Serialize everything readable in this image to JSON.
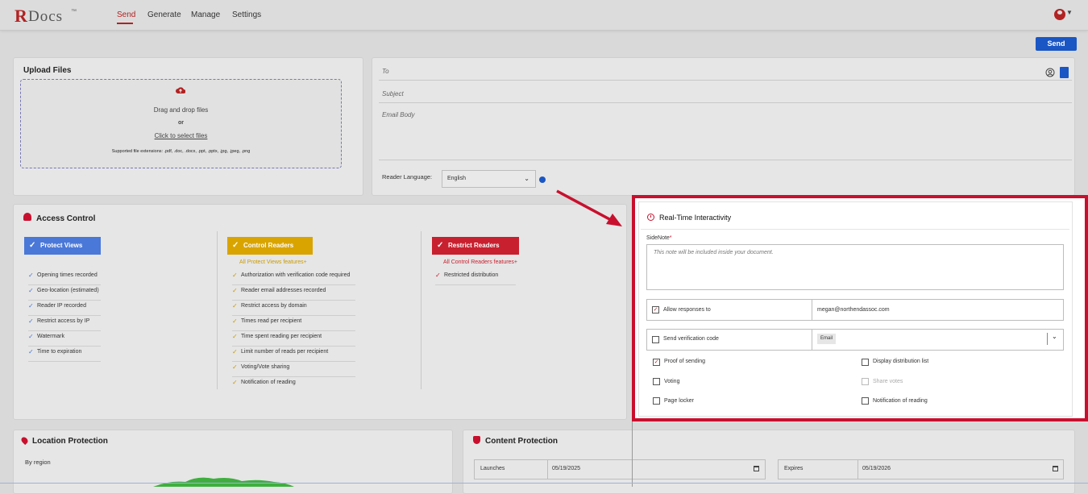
{
  "app": {
    "logo_r": "R",
    "logo_docs": "Docs",
    "logo_tm": "™"
  },
  "nav": {
    "items": [
      "Send",
      "Generate",
      "Manage",
      "Settings"
    ],
    "active": "Send"
  },
  "toolbar": {
    "send_label": "Send"
  },
  "upload": {
    "title": "Upload Files",
    "drag_text": "Drag and drop files",
    "or_text": "or",
    "select_link": "Click to select files",
    "extensions": "Supported file extensions: .pdf, .doc, .docx, .ppt, .pptx, .jpg, .jpeg, .png"
  },
  "compose": {
    "to_label": "To",
    "subject_label": "Subject",
    "body_label": "Email Body",
    "reader_language_label": "Reader Language:",
    "reader_language_value": "English"
  },
  "access": {
    "title": "Access Control",
    "protect": {
      "label": "Protect Views",
      "color": "#4a78d8",
      "features": [
        "Opening times recorded",
        "Geo-location (estimated)",
        "Reader IP recorded",
        "Restrict access by IP",
        "Watermark",
        "Time to expiration"
      ]
    },
    "control": {
      "label": "Control Readers",
      "color": "#d9a400",
      "note": "All Protect Views features+",
      "features": [
        "Authorization with verification code required",
        "Reader email addresses recorded",
        "Restrict access by domain",
        "Times read per recipient",
        "Time spent reading per recipient",
        "Limit number of reads per recipient",
        "Voting/Vote sharing",
        "Notification of reading"
      ]
    },
    "restrict": {
      "label": "Restrict Readers",
      "color": "#c8202f",
      "note": "All Control Readers features+",
      "features": [
        "Restricted distribution"
      ]
    }
  },
  "realtime": {
    "title": "Real-Time Interactivity",
    "sidenote_label": "SideNote",
    "sidenote_required": "*",
    "sidenote_placeholder": "This note will be included inside your document.",
    "allow_responses_label": "Allow responses to",
    "allow_responses_checked": true,
    "allow_responses_email": "megan@northendassoc.com",
    "verification_label": "Send verification code",
    "verification_checked": false,
    "verification_method": "Email",
    "options": [
      {
        "label": "Proof of sending",
        "checked": true,
        "disabled": false
      },
      {
        "label": "Display distribution list",
        "checked": false,
        "disabled": false
      },
      {
        "label": "Voting",
        "checked": false,
        "disabled": false
      },
      {
        "label": "Share votes",
        "checked": false,
        "disabled": true
      },
      {
        "label": "Page locker",
        "checked": false,
        "disabled": false
      },
      {
        "label": "Notification of reading",
        "checked": false,
        "disabled": false
      }
    ]
  },
  "location": {
    "title": "Location Protection",
    "by_region": "By region"
  },
  "content": {
    "title": "Content Protection",
    "launches_label": "Launches",
    "launches_value": "05/19/2025",
    "expires_label": "Expires",
    "expires_value": "05/19/2026"
  },
  "colors": {
    "accent": "#b22222",
    "primary": "#1a56c4",
    "highlight": "#c8102e"
  }
}
